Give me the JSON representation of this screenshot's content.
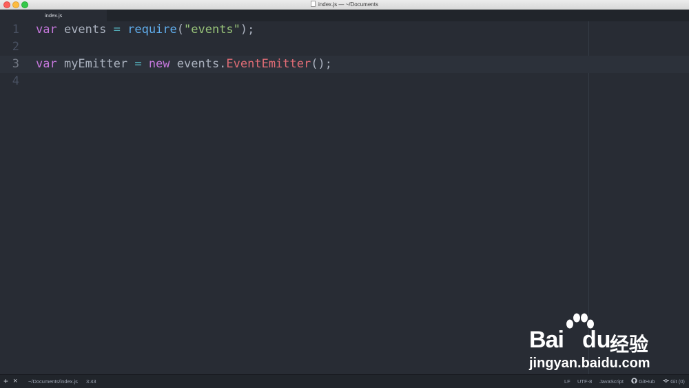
{
  "window": {
    "title": "index.js — ~/Documents"
  },
  "tabs": [
    {
      "label": "index.js",
      "active": true
    }
  ],
  "editor": {
    "lines": [
      {
        "number": "1",
        "tokens": [
          {
            "t": "var",
            "c": "kw"
          },
          {
            "t": " events ",
            "c": "pl"
          },
          {
            "t": "=",
            "c": "op"
          },
          {
            "t": " ",
            "c": "pl"
          },
          {
            "t": "require",
            "c": "fn"
          },
          {
            "t": "(",
            "c": "pl"
          },
          {
            "t": "\"events\"",
            "c": "str"
          },
          {
            "t": ");",
            "c": "pl"
          }
        ]
      },
      {
        "number": "2",
        "tokens": []
      },
      {
        "number": "3",
        "active": true,
        "tokens": [
          {
            "t": "var",
            "c": "kw"
          },
          {
            "t": " myEmitter ",
            "c": "pl"
          },
          {
            "t": "=",
            "c": "op"
          },
          {
            "t": " ",
            "c": "pl"
          },
          {
            "t": "new",
            "c": "kw"
          },
          {
            "t": " events.",
            "c": "pl"
          },
          {
            "t": "EventEmitter",
            "c": "cls"
          },
          {
            "t": "();",
            "c": "pl"
          }
        ]
      },
      {
        "number": "4",
        "tokens": []
      }
    ]
  },
  "statusbar": {
    "add_label": "+",
    "close_label": "×",
    "file_path": "~/Documents/index.js",
    "cursor_position": "3:43",
    "line_ending": "LF",
    "encoding": "UTF-8",
    "grammar": "JavaScript",
    "github_label": "GitHub",
    "git_label": "Git (0)"
  },
  "watermark": {
    "brand_bai": "Bai",
    "brand_du": "du",
    "brand_cn": "经验",
    "url": "jingyan.baidu.com"
  },
  "colors": {
    "background": "#282c34",
    "keyword": "#c678dd",
    "function": "#61afef",
    "string": "#98c379",
    "operator": "#56b6c2",
    "class": "#e06c75"
  }
}
